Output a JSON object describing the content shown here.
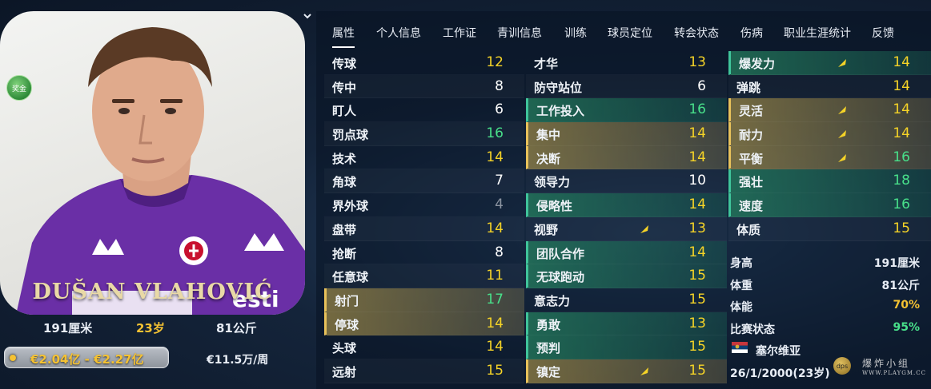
{
  "player": {
    "name": "DUŠAN VLAHOVIĆ",
    "trait_badge": "奖金",
    "height": "191厘米",
    "age": "23岁",
    "weight": "81公斤",
    "value": "€2.04亿 - €2.27亿",
    "wage": "€11.5万/周"
  },
  "tabs": [
    "属性",
    "个人信息",
    "工作证",
    "青训信息",
    "训练",
    "球员定位",
    "转会状态",
    "伤病",
    "职业生涯统计",
    "反馈"
  ],
  "active_tab": "属性",
  "technical": [
    {
      "name": "传球",
      "value": "12",
      "color": "yellow",
      "hl": ""
    },
    {
      "name": "传中",
      "value": "8",
      "color": "white",
      "hl": ""
    },
    {
      "name": "盯人",
      "value": "6",
      "color": "white",
      "hl": ""
    },
    {
      "name": "罚点球",
      "value": "16",
      "color": "green",
      "hl": ""
    },
    {
      "name": "技术",
      "value": "14",
      "color": "yellow",
      "hl": ""
    },
    {
      "name": "角球",
      "value": "7",
      "color": "white",
      "hl": ""
    },
    {
      "name": "界外球",
      "value": "4",
      "color": "gray",
      "hl": ""
    },
    {
      "name": "盘带",
      "value": "14",
      "color": "yellow",
      "hl": ""
    },
    {
      "name": "抢断",
      "value": "8",
      "color": "white",
      "hl": ""
    },
    {
      "name": "任意球",
      "value": "11",
      "color": "yellow",
      "hl": ""
    },
    {
      "name": "射门",
      "value": "17",
      "color": "green",
      "hl": "gold"
    },
    {
      "name": "停球",
      "value": "14",
      "color": "yellow",
      "hl": "gold"
    },
    {
      "name": "头球",
      "value": "14",
      "color": "yellow",
      "hl": ""
    },
    {
      "name": "远射",
      "value": "15",
      "color": "yellow",
      "hl": ""
    }
  ],
  "mental": [
    {
      "name": "才华",
      "value": "13",
      "color": "yellow",
      "hl": "",
      "arrow": false
    },
    {
      "name": "防守站位",
      "value": "6",
      "color": "white",
      "hl": "",
      "arrow": false
    },
    {
      "name": "工作投入",
      "value": "16",
      "color": "green",
      "hl": "green",
      "arrow": false
    },
    {
      "name": "集中",
      "value": "14",
      "color": "yellow",
      "hl": "gold",
      "arrow": false
    },
    {
      "name": "决断",
      "value": "14",
      "color": "yellow",
      "hl": "gold",
      "arrow": false
    },
    {
      "name": "领导力",
      "value": "10",
      "color": "white",
      "hl": "",
      "arrow": false
    },
    {
      "name": "侵略性",
      "value": "14",
      "color": "yellow",
      "hl": "green",
      "arrow": false
    },
    {
      "name": "视野",
      "value": "13",
      "color": "yellow",
      "hl": "",
      "arrow": true
    },
    {
      "name": "团队合作",
      "value": "14",
      "color": "yellow",
      "hl": "green",
      "arrow": false
    },
    {
      "name": "无球跑动",
      "value": "15",
      "color": "yellow",
      "hl": "green",
      "arrow": false
    },
    {
      "name": "意志力",
      "value": "15",
      "color": "yellow",
      "hl": "",
      "arrow": false
    },
    {
      "name": "勇敢",
      "value": "13",
      "color": "yellow",
      "hl": "green",
      "arrow": false
    },
    {
      "name": "预判",
      "value": "15",
      "color": "yellow",
      "hl": "green",
      "arrow": false
    },
    {
      "name": "镇定",
      "value": "15",
      "color": "yellow",
      "hl": "gold",
      "arrow": true
    }
  ],
  "physical": [
    {
      "name": "爆发力",
      "value": "14",
      "color": "yellow",
      "hl": "green",
      "arrow": true
    },
    {
      "name": "弹跳",
      "value": "14",
      "color": "yellow",
      "hl": "",
      "arrow": false
    },
    {
      "name": "灵活",
      "value": "14",
      "color": "yellow",
      "hl": "gold",
      "arrow": true
    },
    {
      "name": "耐力",
      "value": "14",
      "color": "yellow",
      "hl": "gold",
      "arrow": true
    },
    {
      "name": "平衡",
      "value": "16",
      "color": "green",
      "hl": "gold",
      "arrow": true
    },
    {
      "name": "强壮",
      "value": "18",
      "color": "green",
      "hl": "green",
      "arrow": false
    },
    {
      "name": "速度",
      "value": "16",
      "color": "green",
      "hl": "green",
      "arrow": false
    },
    {
      "name": "体质",
      "value": "15",
      "color": "yellow",
      "hl": "",
      "arrow": false
    }
  ],
  "info": {
    "height_label": "身高",
    "height_value": "191厘米",
    "weight_label": "体重",
    "weight_value": "81公斤",
    "fitness_label": "体能",
    "fitness_value": "70%",
    "form_label": "比赛状态",
    "form_value": "95%",
    "nation": "塞尔维亚",
    "dob": "26/1/2000(23岁)"
  },
  "watermark": {
    "text": "爆炸小组",
    "url": "WWW.PLAYGM.CC",
    "logo": "dps"
  },
  "colors": {
    "yellow": "#f5d327",
    "white": "#ffffff",
    "gray": "#8a93a0",
    "green": "#48e08a",
    "fitness": "#f5c232",
    "form": "#48e08a"
  }
}
